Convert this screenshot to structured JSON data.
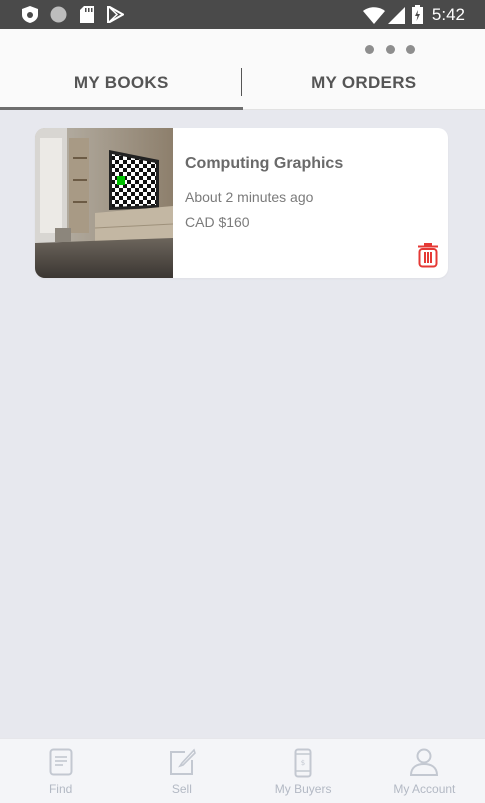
{
  "status_bar": {
    "time": "5:42"
  },
  "tabs": [
    {
      "label": "MY BOOKS",
      "active": true
    },
    {
      "label": "MY ORDERS",
      "active": false
    }
  ],
  "books": [
    {
      "title": "Computing Graphics",
      "posted": "About 2 minutes ago",
      "price": "CAD $160"
    }
  ],
  "bottom_nav": [
    {
      "label": "Find",
      "icon": "document-icon"
    },
    {
      "label": "Sell",
      "icon": "edit-icon"
    },
    {
      "label": "My Buyers",
      "icon": "phone-icon"
    },
    {
      "label": "My Account",
      "icon": "person-icon"
    }
  ],
  "colors": {
    "delete": "#e53935",
    "nav_inactive": "#b3b9c4",
    "background": "#e7e8ee"
  }
}
